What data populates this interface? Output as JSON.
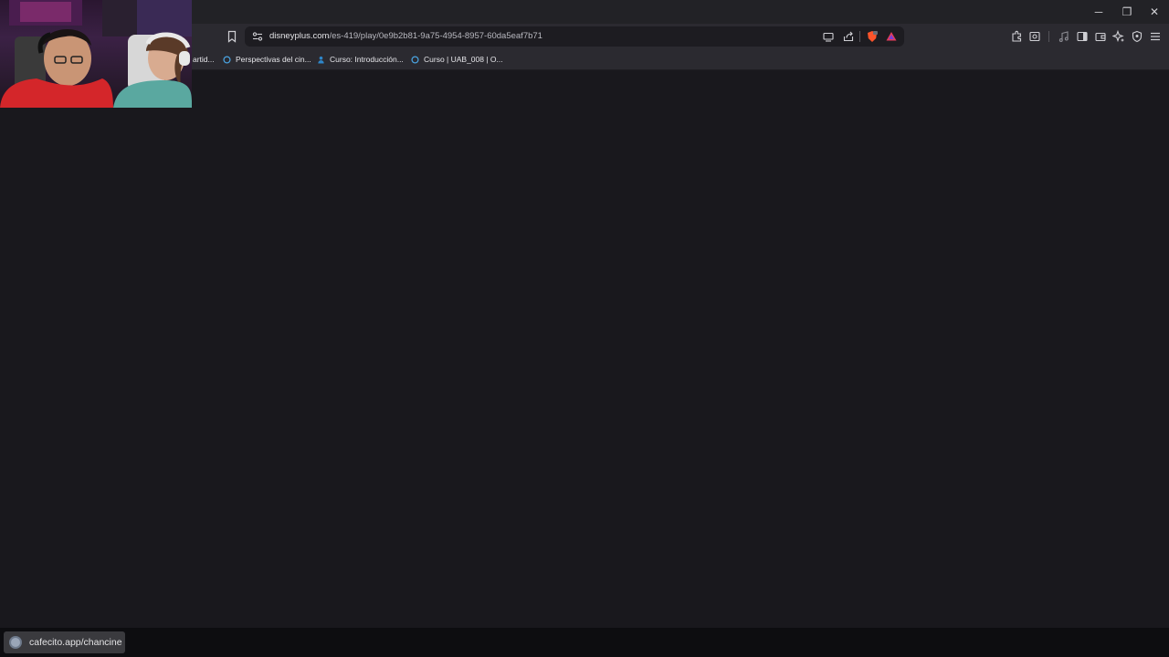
{
  "browser": {
    "url": {
      "domain": "disneyplus.com",
      "path": "/es-419/play/0e9b2b81-9a75-4954-8957-60da5eaf7b71"
    },
    "window_controls": {
      "minimize_glyph": "─",
      "restore_glyph": "❐",
      "close_glyph": "✕"
    },
    "bookmarks": [
      {
        "label": "artid...",
        "icon": "bookmark-favicon"
      },
      {
        "label": "Perspectivas del cin...",
        "icon": "circle-favicon"
      },
      {
        "label": "Curso: Introducción...",
        "icon": "person-favicon"
      },
      {
        "label": "Curso | UAB_008 | O...",
        "icon": "circle-favicon"
      }
    ],
    "toolbar_icons": [
      "bookmark-icon",
      "site-info-icon",
      "cast-icon",
      "share-icon",
      "brave-shield-icon",
      "brave-rewards-icon",
      "extensions-icon",
      "screenshot-icon",
      "media-icon",
      "sidebar-icon",
      "wallet-icon",
      "leo-ai-icon",
      "vpn-icon",
      "menu-icon"
    ]
  },
  "overlay": {
    "webcam": "webcam-feed",
    "status_text": "cafecito.app/chancine"
  },
  "colors": {
    "page_bg": "#19181d",
    "toolbar_bg": "#2b2a30",
    "titlebar_bg": "#222226",
    "brave_orange": "#fb542b",
    "rewards_red": "#e33d5b"
  }
}
